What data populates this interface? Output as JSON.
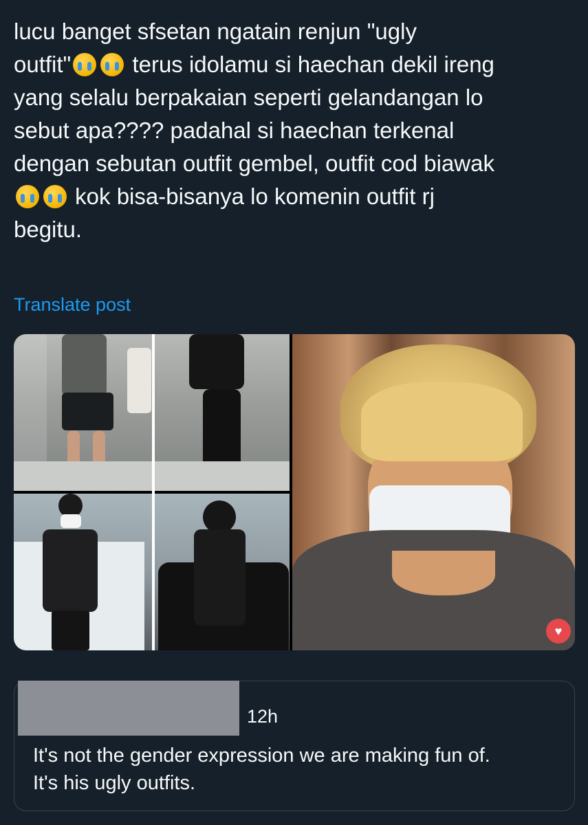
{
  "post": {
    "lines": [
      "lucu banget sfsetan ngatain renjun \"ugly",
      "outfit\"",
      " terus idolamu si haechan dekil ireng",
      "yang selalu berpakaian seperti gelandangan lo",
      "sebut apa????  padahal si haechan terkenal",
      "dengan sebutan outfit gembel, outfit cod biawak",
      " kok bisa-bisanya lo komenin outfit rj",
      "begitu."
    ],
    "emoji": "loudly-crying-face-emoji"
  },
  "translate_label": "Translate post",
  "media": {
    "left_photos": [
      "airport-outfit-photo-1",
      "airport-outfit-photo-2"
    ],
    "right_photo": "masked-person-photo"
  },
  "quoted_reply": {
    "time": "12h",
    "text_line1": "It's not the gender expression we are making fun of.",
    "text_line2": "It's his ugly outfits."
  },
  "colors": {
    "background": "#15202b",
    "text": "#f7f9f9",
    "link": "#1d9bf0",
    "border": "#38444d"
  }
}
